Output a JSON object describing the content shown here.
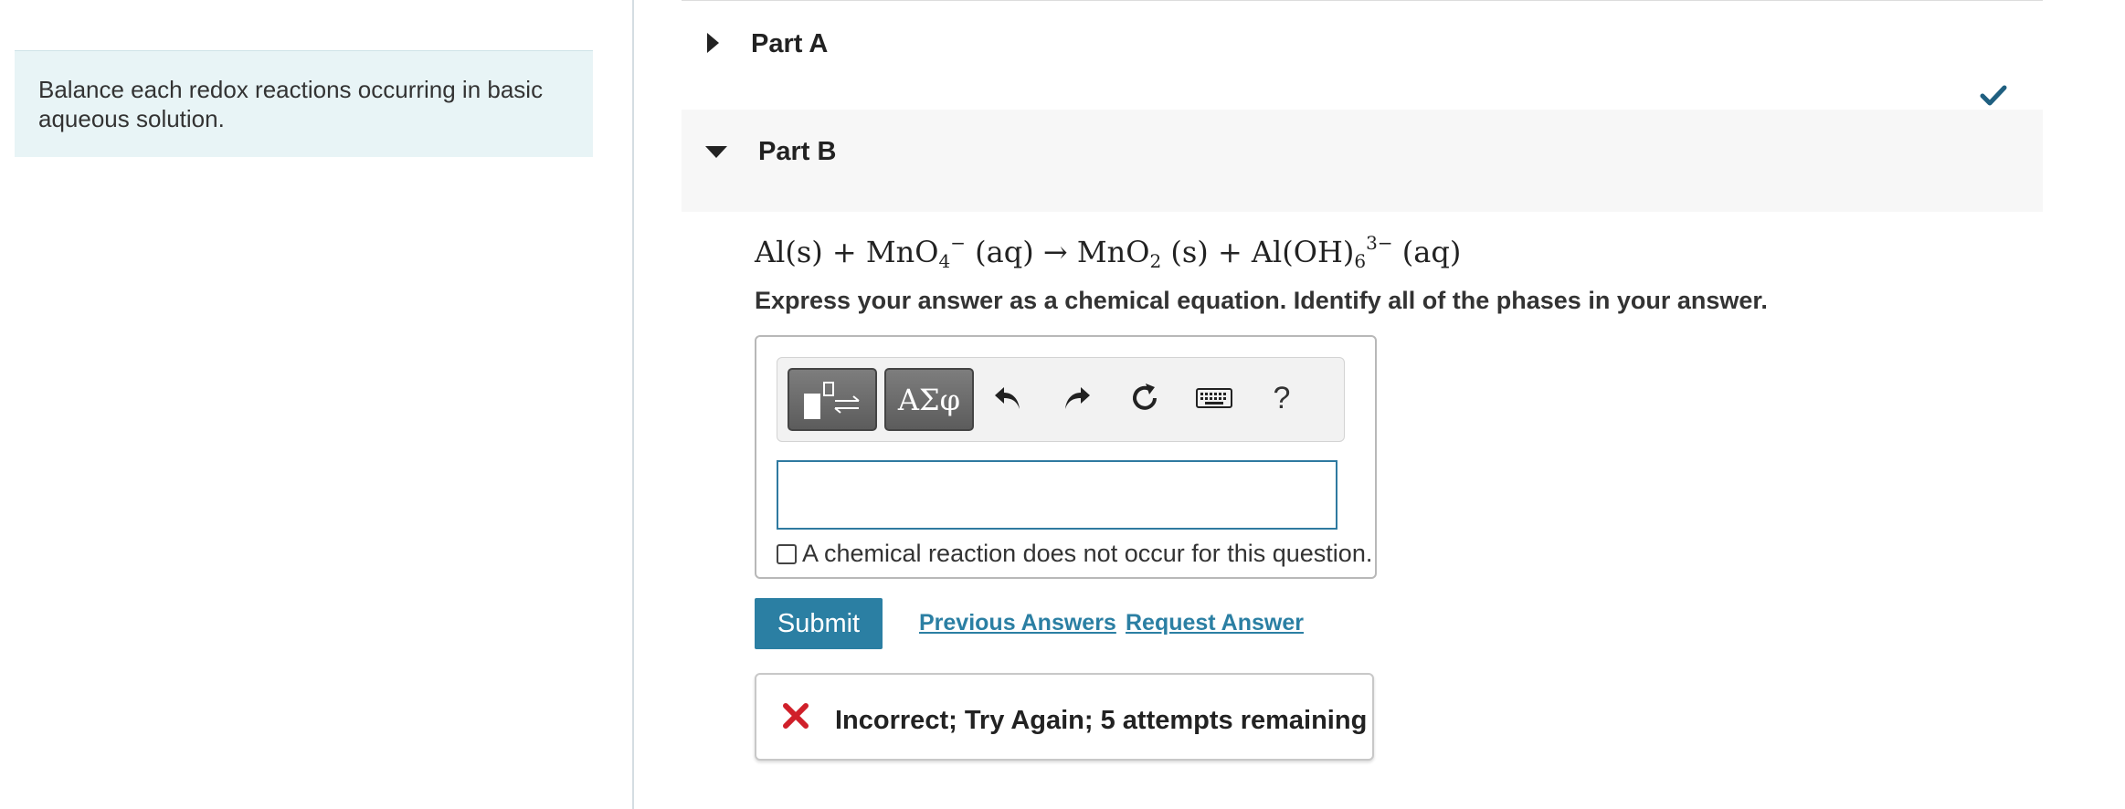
{
  "intro": {
    "text": "Balance each redox reactions occurring in basic aqueous solution."
  },
  "parts": {
    "a": {
      "title": "Part A",
      "status_icon": "checkmark-icon"
    },
    "b": {
      "title": "Part B"
    }
  },
  "equation": {
    "t1": "Al(s) + MnO",
    "t1_sub": "4",
    "t1_sup": "−",
    "t2": "(aq) → MnO",
    "t2_sub": "2",
    "t3": "(s) + Al(OH)",
    "t3_sub": "6",
    "t3_sup": "3−",
    "t4": "(aq)"
  },
  "instruction": "Express your answer as a chemical equation. Identify all of the phases in your answer.",
  "toolbar": {
    "greek_label": "ΑΣφ",
    "help_label": "?"
  },
  "answer": {
    "value": "",
    "no_reaction_label": "A chemical reaction does not occur for this question."
  },
  "actions": {
    "submit_label": "Submit",
    "previous_answers_label": "Previous Answers",
    "request_answer_label": "Request Answer"
  },
  "feedback": {
    "text": "Incorrect; Try Again; 5 attempts remaining",
    "icon": "x-icon"
  },
  "colors": {
    "accent": "#2b7fa3",
    "intro_bg": "#e8f4f6",
    "check": "#1f5f80",
    "error": "#d0202a"
  }
}
